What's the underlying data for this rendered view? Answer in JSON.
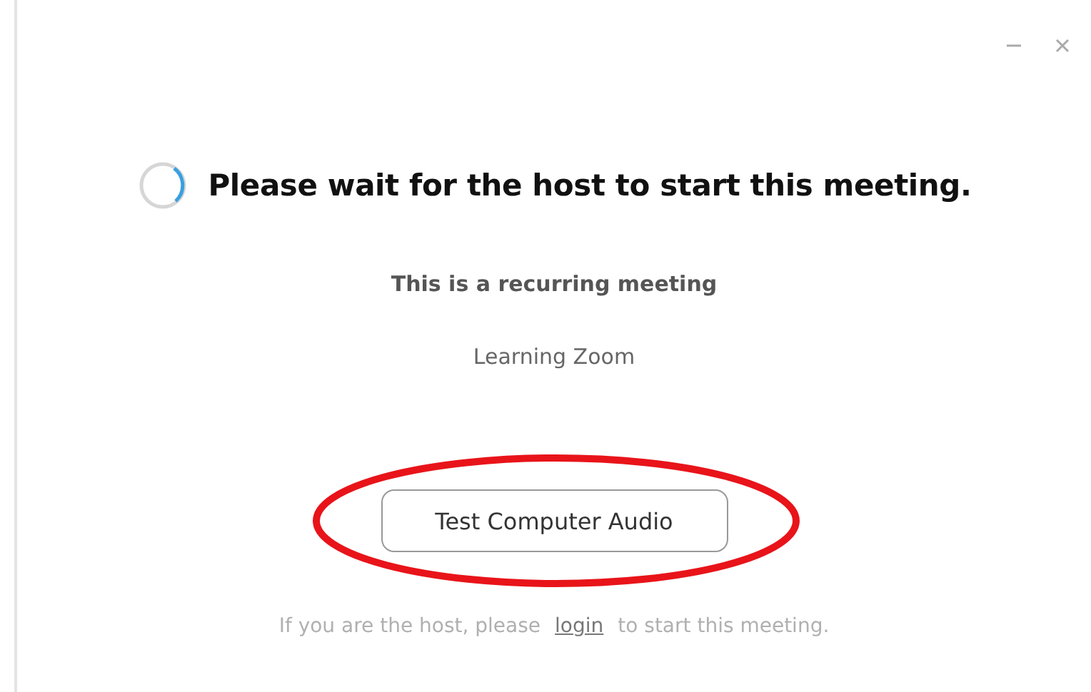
{
  "window": {
    "controls": [
      {
        "kind": "minimize"
      },
      {
        "kind": "close"
      }
    ]
  },
  "heading": "Please wait for the host to start this meeting.",
  "subtitle": "This is a recurring meeting",
  "meeting_name": "Learning Zoom",
  "button": {
    "label": "Test Computer Audio",
    "annotated": true
  },
  "footer": {
    "before": "If you are the host, please",
    "link": "login",
    "after": "to start this meeting."
  }
}
